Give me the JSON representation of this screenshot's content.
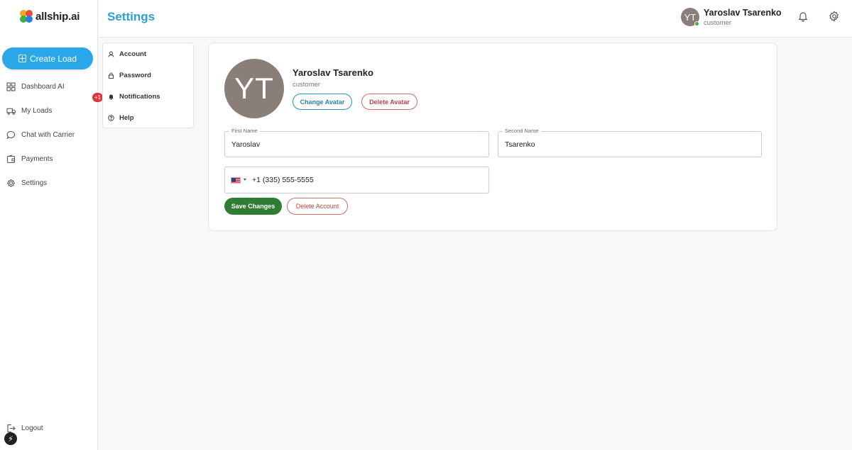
{
  "brand": {
    "name": "allship.ai",
    "accent": "#2aa7e8"
  },
  "sidebar": {
    "create_label": "Create Load",
    "items": [
      {
        "label": "Dashboard AI",
        "icon": "grid-icon"
      },
      {
        "label": "My Loads",
        "icon": "truck-icon"
      },
      {
        "label": "Chat with Carrier",
        "icon": "chat-icon"
      },
      {
        "label": "Payments",
        "icon": "wallet-icon"
      },
      {
        "label": "Settings",
        "icon": "gear-icon"
      }
    ],
    "badge": "+1",
    "logout_label": "Logout"
  },
  "header": {
    "title": "Settings",
    "user": {
      "initials": "YT",
      "name": "Yaroslav Tsarenko",
      "role": "customer",
      "status": "online"
    }
  },
  "settings_menu": [
    {
      "label": "Account",
      "icon": "user-icon"
    },
    {
      "label": "Password",
      "icon": "lock-icon"
    },
    {
      "label": "Notifications",
      "icon": "bell-icon"
    },
    {
      "label": "Help",
      "icon": "help-icon"
    }
  ],
  "profile": {
    "initials": "YT",
    "name": "Yaroslav Tsarenko",
    "role": "customer",
    "change_avatar_label": "Change Avatar",
    "delete_avatar_label": "Delete Avatar"
  },
  "form": {
    "first_name": {
      "label": "First Name",
      "value": "Yaroslav"
    },
    "second_name": {
      "label": "Second Name",
      "value": "Tsarenko"
    },
    "phone": {
      "value": "+1 (335) 555-5555",
      "country": "US"
    },
    "save_label": "Save Changes",
    "delete_account_label": "Delete Account"
  }
}
